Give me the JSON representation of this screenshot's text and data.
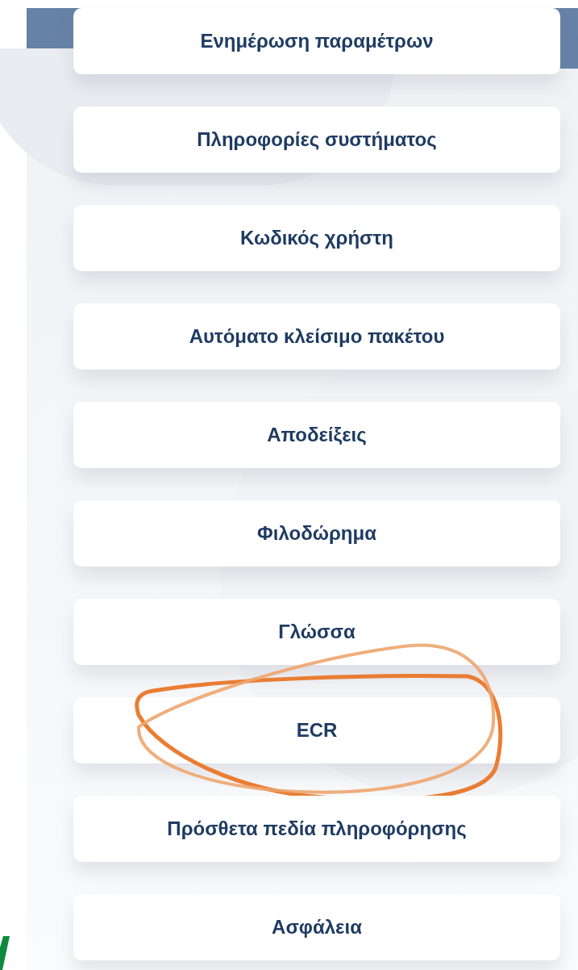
{
  "menu": {
    "items": [
      {
        "label": "Ενημέρωση παραμέτρων",
        "circled": false
      },
      {
        "label": "Πληροφορίες συστήματος",
        "circled": false
      },
      {
        "label": "Κωδικός χρήστη",
        "circled": false
      },
      {
        "label": "Αυτόματο κλείσιμο πακέτου",
        "circled": false
      },
      {
        "label": "Αποδείξεις",
        "circled": false
      },
      {
        "label": "Φιλοδώρημα",
        "circled": false
      },
      {
        "label": "Γλώσσα",
        "circled": false
      },
      {
        "label": "ECR",
        "circled": true
      },
      {
        "label": "Πρόσθετα πεδία πληροφόρησης",
        "circled": false
      },
      {
        "label": "Ασφάλεια",
        "circled": false
      }
    ]
  }
}
